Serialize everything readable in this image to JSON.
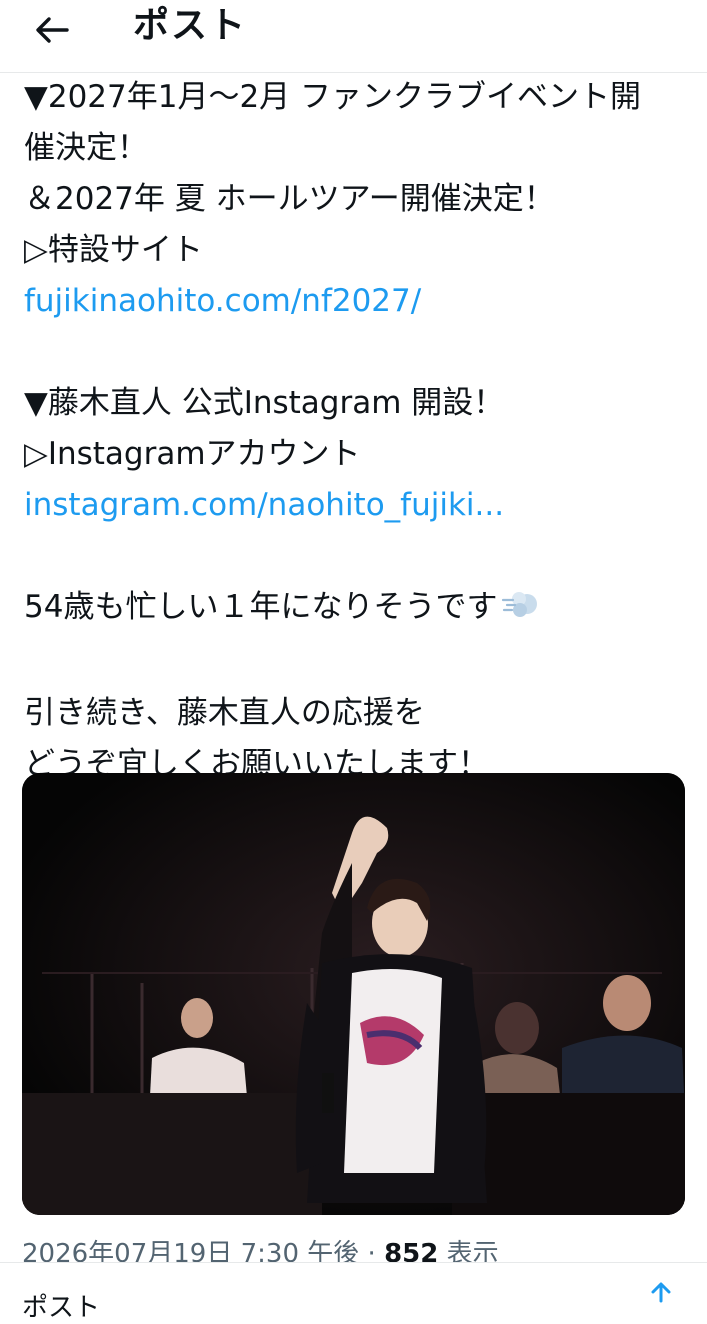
{
  "header": {
    "title": "ポスト",
    "back_icon": "arrow-left-icon"
  },
  "tweet": {
    "lines": [
      "▼2027年1月〜2月 ファンクラブイベント開",
      "催決定！",
      "＆2027年 夏 ホールツアー開催決定！",
      "▷特設サイト"
    ],
    "link1": "fujikinaohito.com/nf2027/",
    "section2_title": "▼藤木直人 公式Instagram 開設！",
    "section2_label": "▷Instagramアカウント",
    "link2": "instagram.com/naohito_fujiki...",
    "message1": "54歳も忙しい１年になりそうです",
    "emoji": "dash-icon",
    "closing1": "引き続き、藤木直人の応援を",
    "closing2": "どうぞ宜しくお願いいたします！"
  },
  "meta": {
    "timestamp": "2026年07月19日 7:30 午後",
    "separator": " · ",
    "views_count": "852",
    "views_label": " 表示"
  },
  "bottom": {
    "partial_text": "ポスト",
    "share_icon": "share-icon"
  },
  "colors": {
    "link": "#1d9bf0",
    "text": "#0f1419",
    "secondary": "#536471",
    "border": "#e7e9ea"
  }
}
